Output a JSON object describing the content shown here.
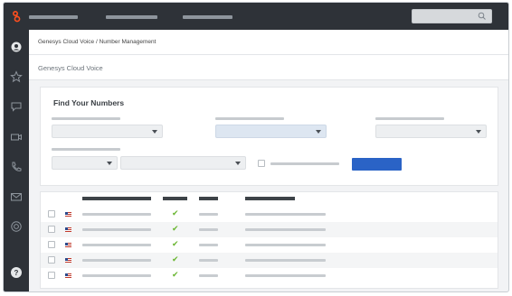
{
  "breadcrumb": "Genesys Cloud Voice / Number Management",
  "page_title": "Genesys Cloud Voice",
  "search": {
    "label": "Find Your Numbers"
  },
  "colors": {
    "topbar": "#2e3238",
    "brand": "#ff4f1f",
    "primary_button": "#2a63c6",
    "check": "#6ab632"
  },
  "icons": {
    "logo": "genesys-logo-icon",
    "sidebar": [
      "user-profile-icon",
      "star-icon",
      "chat-icon",
      "video-icon",
      "phone-icon",
      "mail-icon",
      "globe-icon",
      "help-icon"
    ],
    "row_flag": "us-flag-icon",
    "row_status": "checkmark-icon"
  },
  "help_icon_label": "?",
  "check_glyph": "✔",
  "rows": [
    {
      "status": "✔"
    },
    {
      "status": "✔"
    },
    {
      "status": "✔"
    },
    {
      "status": "✔"
    },
    {
      "status": "✔"
    }
  ]
}
